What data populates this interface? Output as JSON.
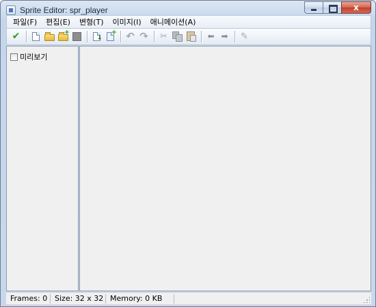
{
  "window": {
    "title": "Sprite Editor: spr_player",
    "close_glyph": "x"
  },
  "menu": {
    "items": [
      "파일(F)",
      "편집(E)",
      "변형(T)",
      "이미지(I)",
      "애니메이션(A)"
    ]
  },
  "toolbar": {
    "icons": [
      "confirm-check-icon",
      "new-file-icon",
      "open-folder-icon",
      "add-folder-icon",
      "stop-square-icon",
      "import-icon",
      "add-image-icon",
      "undo-icon",
      "redo-icon",
      "cut-icon",
      "copy-icon",
      "paste-icon",
      "arrow-left-icon",
      "arrow-right-icon",
      "pencil-icon"
    ],
    "colors": {
      "check": "#2e9a1e",
      "arrow": "#7a8aa0",
      "disabled": "#a0a8b4"
    },
    "glyphs": {
      "check": "✔",
      "undo": "↶",
      "redo": "↷",
      "cut": "✂",
      "left": "⬅",
      "right": "➡",
      "pencil": "✎"
    }
  },
  "left_panel": {
    "preview_label": "미리보기",
    "preview_checked": false
  },
  "status": {
    "frames": "Frames: 0",
    "size": "Size: 32 x 32",
    "memory": "Memory: 0 KB"
  }
}
